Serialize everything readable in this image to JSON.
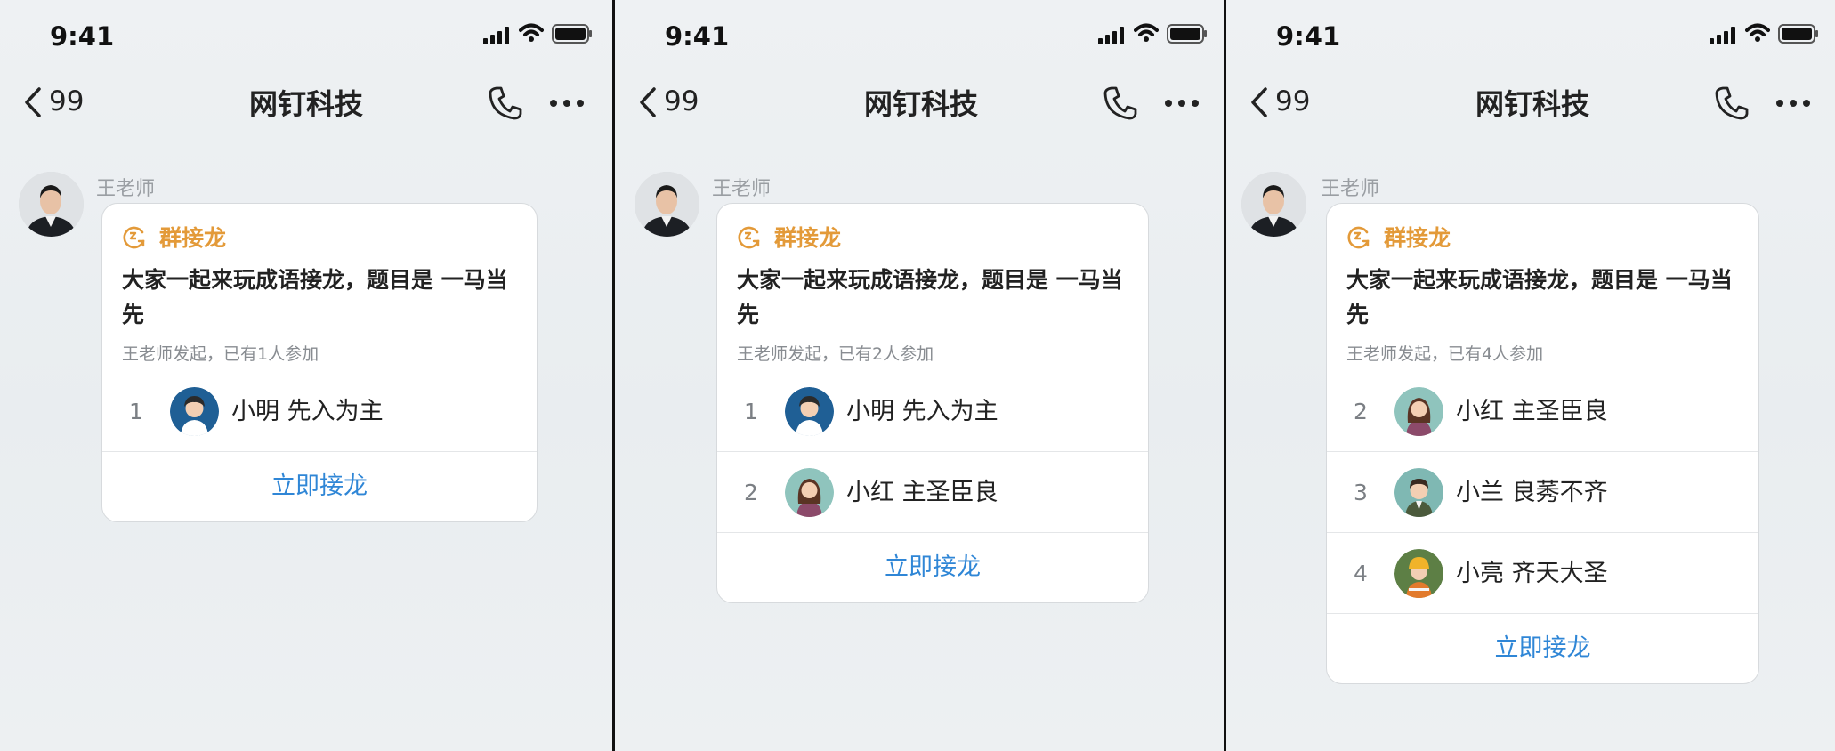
{
  "screens": [
    {
      "status_time": "9:41",
      "nav": {
        "back_count": "99",
        "title": "网钉科技"
      },
      "message": {
        "sender": "王老师",
        "card": {
          "tag": "群接龙",
          "title": "大家一起来玩成语接龙，题目是 一马当先",
          "subtitle": "王老师发起，已有1人参加",
          "entries": [
            {
              "num": "1",
              "text": "小明 先入为主",
              "avatar": "boy"
            }
          ],
          "action": "立即接龙"
        }
      }
    },
    {
      "status_time": "9:41",
      "nav": {
        "back_count": "99",
        "title": "网钉科技"
      },
      "message": {
        "sender": "王老师",
        "card": {
          "tag": "群接龙",
          "title": "大家一起来玩成语接龙，题目是 一马当先",
          "subtitle": "王老师发起，已有2人参加",
          "entries": [
            {
              "num": "1",
              "text": "小明 先入为主",
              "avatar": "boy"
            },
            {
              "num": "2",
              "text": "小红 主圣臣良",
              "avatar": "girl"
            }
          ],
          "action": "立即接龙"
        }
      }
    },
    {
      "status_time": "9:41",
      "nav": {
        "back_count": "99",
        "title": "网钉科技"
      },
      "message": {
        "sender": "王老师",
        "card": {
          "tag": "群接龙",
          "title": "大家一起来玩成语接龙，题目是 一马当先",
          "subtitle": "王老师发起，已有4人参加",
          "entries": [
            {
              "num": "2",
              "text": "小红 主圣臣良",
              "avatar": "girl"
            },
            {
              "num": "3",
              "text": "小兰 良莠不齐",
              "avatar": "man-teal"
            },
            {
              "num": "4",
              "text": "小亮 齐天大圣",
              "avatar": "worker-green"
            }
          ],
          "action": "立即接龙"
        }
      }
    }
  ],
  "colors": {
    "tag": "#e39a39",
    "action": "#2f86d6"
  }
}
